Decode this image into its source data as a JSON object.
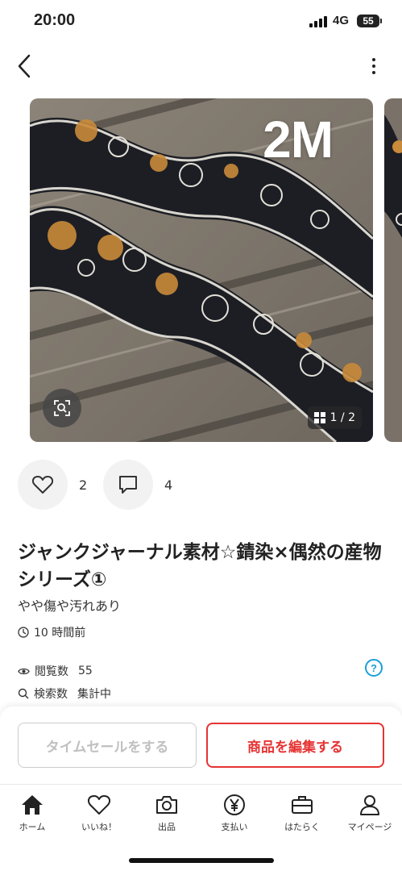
{
  "status_bar": {
    "time": "20:00",
    "network": "4G",
    "battery": "55"
  },
  "gallery": {
    "overlay_text": "2M",
    "counter": "1 / 2"
  },
  "reactions": {
    "likes": "2",
    "comments": "4"
  },
  "item": {
    "title": "ジャンクジャーナル素材☆錆染×偶然の産物シリーズ①",
    "condition": "やや傷や汚れあり",
    "posted_ago": "10 時間前"
  },
  "stats": {
    "views_label": "閲覧数",
    "views_value": "55",
    "search_label": "検索数",
    "search_value": "集計中"
  },
  "actions": {
    "timesale": "タイムセールをする",
    "edit": "商品を編集する"
  },
  "tabs": [
    {
      "label": "ホーム",
      "icon": "home-icon"
    },
    {
      "label": "いいね！",
      "icon": "heart-icon"
    },
    {
      "label": "出品",
      "icon": "camera-icon"
    },
    {
      "label": "支払い",
      "icon": "yen-icon"
    },
    {
      "label": "はたらく",
      "icon": "briefcase-icon"
    },
    {
      "label": "マイページ",
      "icon": "person-icon"
    }
  ],
  "colors": {
    "accent": "#e63333",
    "help": "#1aa0d8"
  }
}
